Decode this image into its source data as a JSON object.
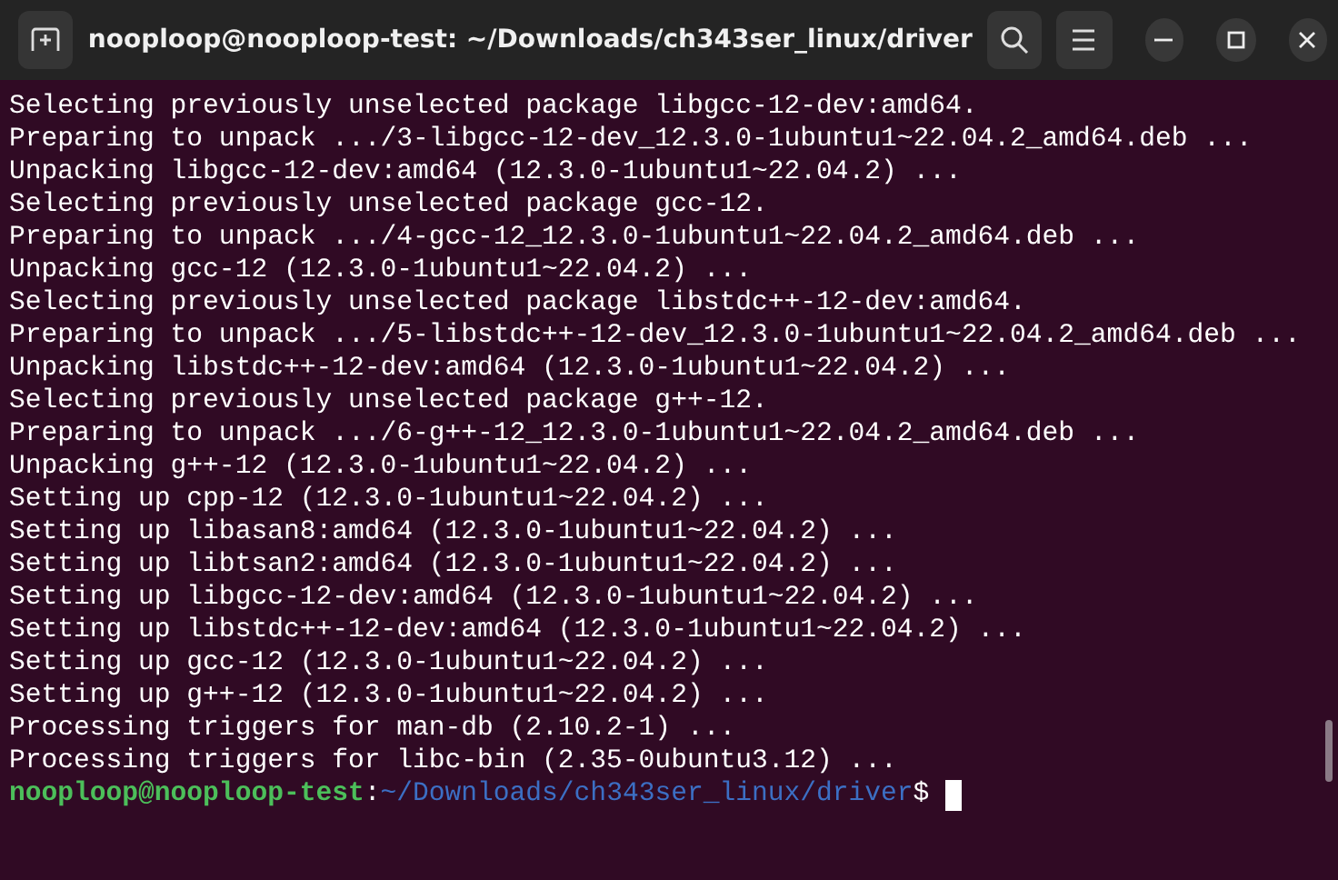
{
  "window": {
    "title": "nooploop@nooploop-test: ~/Downloads/ch343ser_linux/driver"
  },
  "output_lines": [
    "Selecting previously unselected package libgcc-12-dev:amd64.",
    "Preparing to unpack .../3-libgcc-12-dev_12.3.0-1ubuntu1~22.04.2_amd64.deb ...",
    "Unpacking libgcc-12-dev:amd64 (12.3.0-1ubuntu1~22.04.2) ...",
    "Selecting previously unselected package gcc-12.",
    "Preparing to unpack .../4-gcc-12_12.3.0-1ubuntu1~22.04.2_amd64.deb ...",
    "Unpacking gcc-12 (12.3.0-1ubuntu1~22.04.2) ...",
    "Selecting previously unselected package libstdc++-12-dev:amd64.",
    "Preparing to unpack .../5-libstdc++-12-dev_12.3.0-1ubuntu1~22.04.2_amd64.deb ...",
    "Unpacking libstdc++-12-dev:amd64 (12.3.0-1ubuntu1~22.04.2) ...",
    "Selecting previously unselected package g++-12.",
    "Preparing to unpack .../6-g++-12_12.3.0-1ubuntu1~22.04.2_amd64.deb ...",
    "Unpacking g++-12 (12.3.0-1ubuntu1~22.04.2) ...",
    "Setting up cpp-12 (12.3.0-1ubuntu1~22.04.2) ...",
    "Setting up libasan8:amd64 (12.3.0-1ubuntu1~22.04.2) ...",
    "Setting up libtsan2:amd64 (12.3.0-1ubuntu1~22.04.2) ...",
    "Setting up libgcc-12-dev:amd64 (12.3.0-1ubuntu1~22.04.2) ...",
    "Setting up libstdc++-12-dev:amd64 (12.3.0-1ubuntu1~22.04.2) ...",
    "Setting up gcc-12 (12.3.0-1ubuntu1~22.04.2) ...",
    "Setting up g++-12 (12.3.0-1ubuntu1~22.04.2) ...",
    "Processing triggers for man-db (2.10.2-1) ...",
    "Processing triggers for libc-bin (2.35-0ubuntu3.12) ..."
  ],
  "prompt": {
    "user_host": "nooploop@nooploop-test",
    "separator": ":",
    "path": "~/Downloads/ch343ser_linux/driver",
    "symbol": "$"
  }
}
